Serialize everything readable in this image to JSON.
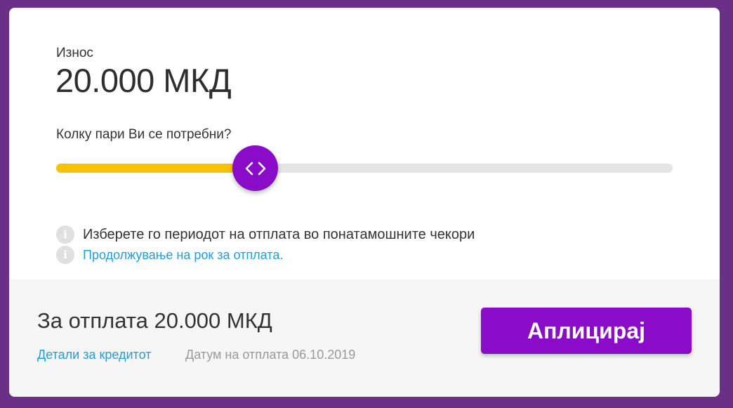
{
  "amount": {
    "label": "Износ",
    "value": "20.000 МКД"
  },
  "slider": {
    "question": "Колку пари Ви се потребни?",
    "fill_percent": 32.4,
    "thumb_icon": "chevrons-left-right-icon",
    "colors": {
      "fill": "#f7c300",
      "track": "#e5e5e5",
      "thumb": "#8a0bc8"
    }
  },
  "info": [
    {
      "icon": "info-icon",
      "text": "Изберете го периодот на отплата во понатамошните чекори"
    },
    {
      "icon": "info-icon",
      "text": "Продолжување на рок за отплата."
    }
  ],
  "footer": {
    "repay_text": "За отплата 20.000 МКД",
    "details_link": "Детали за кредитот",
    "pay_date": "Датум на отплата 06.10.2019",
    "apply_label": "Аплицирај"
  },
  "colors": {
    "background": "#6a2f87",
    "accent": "#8a0bc8",
    "link": "#1d9fe0"
  }
}
